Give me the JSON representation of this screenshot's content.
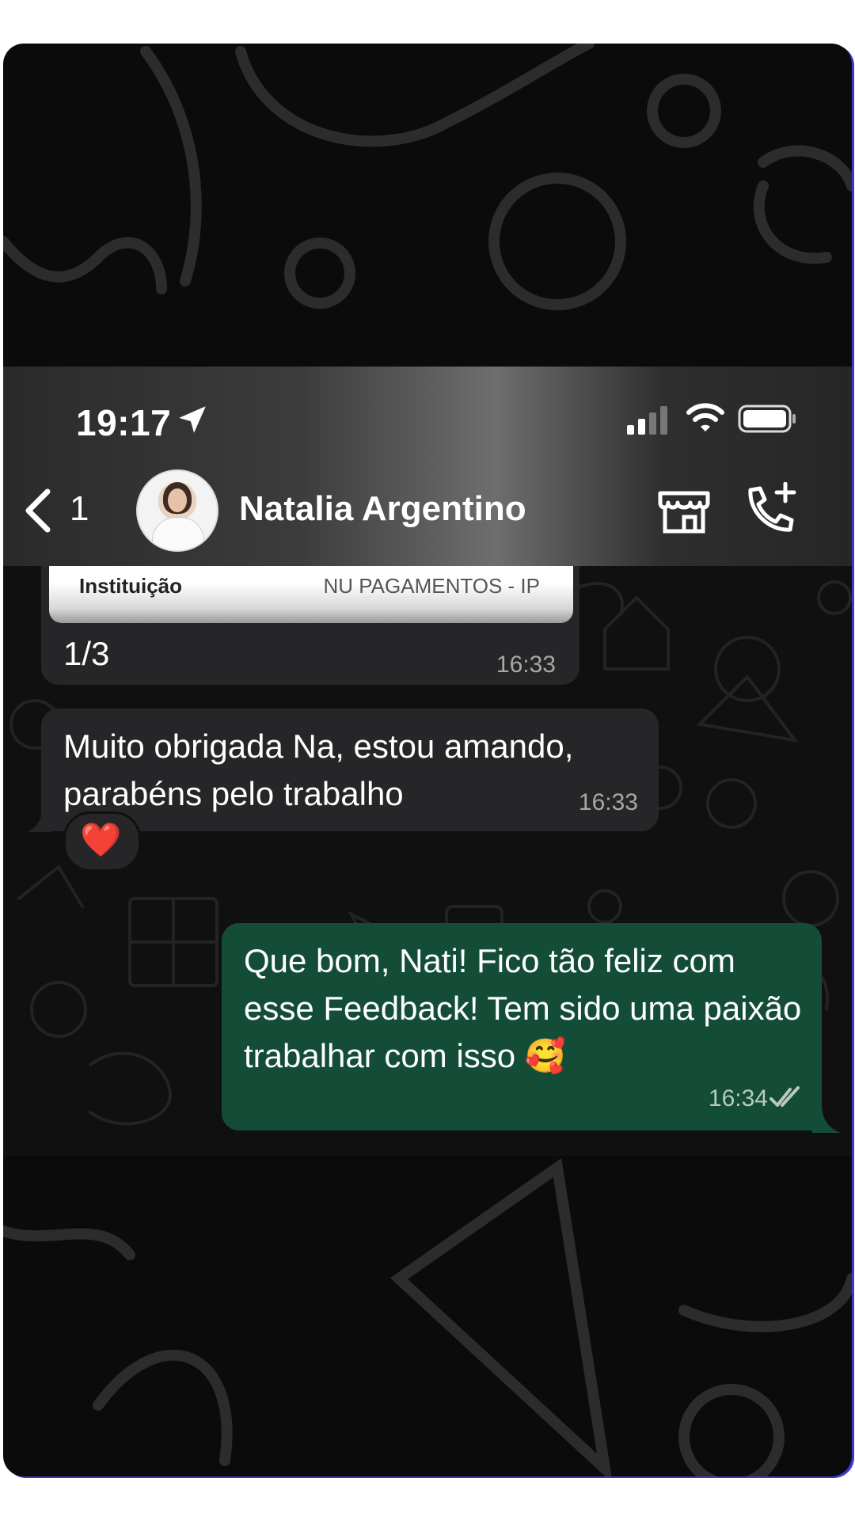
{
  "status_bar": {
    "time": "19:17"
  },
  "header": {
    "back_count": "1",
    "contact_name": "Natalia Argentino",
    "icons": [
      "location-arrow-icon",
      "signal-icon",
      "wifi-icon",
      "battery-icon",
      "back-chevron-icon",
      "store-icon",
      "call-add-icon"
    ]
  },
  "messages": [
    {
      "direction": "incoming",
      "attachment": {
        "label": "Instituição",
        "value": "NU PAGAMENTOS - IP"
      },
      "text": "1/3",
      "time": "16:33"
    },
    {
      "direction": "incoming",
      "text": "Muito obrigada Na,  estou amando, parabéns pelo trabalho",
      "time": "16:33",
      "reaction": "❤️"
    },
    {
      "direction": "outgoing",
      "text": "Que bom, Nati! Fico tão feliz com esse Feedback! Tem sido uma paixão trabalhar com isso 🥰",
      "time": "16:34",
      "status": "read"
    }
  ],
  "colors": {
    "incoming_bubble": "#262628",
    "outgoing_bubble": "#144d37",
    "background": "#0b0b0c"
  }
}
